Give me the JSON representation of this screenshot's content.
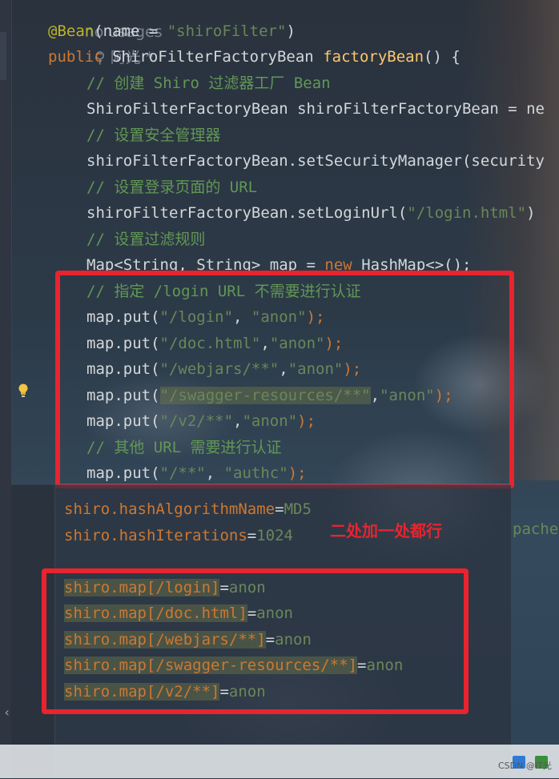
{
  "editor_top": {
    "usage_hint": "no usages",
    "author_hint": "阿光 *",
    "lines": [
      {
        "ann": "@Bean",
        "p1": "(name = ",
        "s1": "\"shiroFilter\"",
        "p2": ")"
      },
      {
        "kw": "public",
        "type": " ShiroFilterFactoryBean ",
        "fn": "factoryBean",
        "rest": "() {"
      },
      {
        "cm": "// 创建 Shiro 过滤器工厂 Bean"
      },
      {
        "code": "ShiroFilterFactoryBean shiroFilterFactoryBean = ne"
      },
      {
        "cm": "// 设置安全管理器"
      },
      {
        "code": "shiroFilterFactoryBean.setSecurityManager(security"
      },
      {
        "cm": "// 设置登录页面的 URL"
      },
      {
        "pre": "shiroFilterFactoryBean.setLoginUrl(",
        "s": "\"/login.html\"",
        "post": ")"
      },
      {
        "cm": "// 设置过滤规则"
      },
      {
        "pre": "Map<String, String> map = ",
        "kw": "new",
        "post": " HashMap<>();"
      },
      {
        "cm": "// 指定 /login URL 不需要进行认证"
      },
      {
        "pre": "map.put(",
        "s1": "\"/login\"",
        "mid": ", ",
        "s2": "\"anon\"",
        "post": ");"
      },
      {
        "pre": "map.put(",
        "s1": "\"/doc.html\"",
        "mid": ",",
        "s2": "\"anon\"",
        "post": ");"
      },
      {
        "pre": "map.put(",
        "s1": "\"/webjars/**\"",
        "mid": ",",
        "s2": "\"anon\"",
        "post": ");"
      },
      {
        "pre": "map.put(",
        "s1": "\"/swagger-resources/**\"",
        "mid": ",",
        "s2": "\"anon\"",
        "post": ");"
      },
      {
        "pre": "map.put(",
        "s1": "\"/v2/**\"",
        "mid": ",",
        "s2": "\"anon\"",
        "post": ");"
      },
      {
        "cm": "// 其他 URL 需要进行认证"
      },
      {
        "pre": "map.put(",
        "s1": "\"/**\"",
        "mid": ", ",
        "s2": "\"authc\"",
        "post": ");"
      }
    ]
  },
  "properties": {
    "lines": [
      {
        "key": "shiro.hashAlgorithmName",
        "val": "MD5"
      },
      {
        "key": "shiro.hashIterations",
        "val": "1024"
      },
      {
        "key": "shiro.map[/login]",
        "val": "anon"
      },
      {
        "key": "shiro.map[/doc.html]",
        "val": "anon"
      },
      {
        "key": "shiro.map[/webjars/**]",
        "val": "anon"
      },
      {
        "key": "shiro.map[/swagger-resources/**]",
        "val": "anon"
      },
      {
        "key": "shiro.map[/v2/**]",
        "val": "anon"
      }
    ],
    "partial_right_text": "pache."
  },
  "annotation_note": "二处加一处都行",
  "watermark": "CSDN @IT光",
  "colors": {
    "highlight_box": "#e8242e",
    "keyword": "#cc7832",
    "string": "#6a8759",
    "comment": "#629755",
    "annotation": "#bbb529",
    "method": "#ffc66d"
  }
}
